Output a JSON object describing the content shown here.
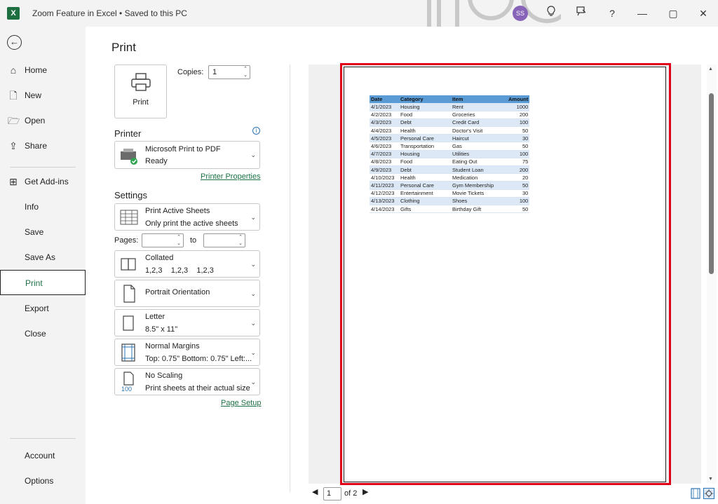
{
  "titlebar": {
    "app_logo": "X",
    "title": "Zoom Feature in Excel • Saved to this PC",
    "avatar_initials": "SS",
    "icons": [
      "lightbulb-icon",
      "coauthor-icon",
      "help-icon",
      "minimize-icon",
      "restore-icon",
      "close-icon"
    ],
    "glyphs": {
      "help": "?",
      "minimize": "—",
      "restore": "▢",
      "close": "✕"
    }
  },
  "nav": {
    "back_glyph": "←",
    "items": [
      {
        "label": "Home",
        "icon": "home-icon",
        "glyph": "⌂"
      },
      {
        "label": "New",
        "icon": "new-document-icon",
        "glyph": "🗋"
      },
      {
        "label": "Open",
        "icon": "open-folder-icon",
        "glyph": "🗁"
      },
      {
        "label": "Share",
        "icon": "share-icon",
        "glyph": "⇪"
      },
      {
        "label": "Get Add-ins",
        "icon": "add-ins-icon",
        "glyph": "⊞"
      },
      {
        "label": "Info"
      },
      {
        "label": "Save"
      },
      {
        "label": "Save As"
      },
      {
        "label": "Print",
        "active": true
      },
      {
        "label": "Export"
      },
      {
        "label": "Close"
      },
      {
        "label": "Account"
      },
      {
        "label": "Options"
      }
    ]
  },
  "print": {
    "title": "Print",
    "print_button_label": "Print",
    "copies_label": "Copies:",
    "copies_value": "1",
    "printer_heading": "Printer",
    "printer_name": "Microsoft Print to PDF",
    "printer_status": "Ready",
    "printer_properties_link": "Printer Properties",
    "settings_heading": "Settings",
    "settings": [
      {
        "line1": "Print Active Sheets",
        "line2": "Only print the active sheets",
        "icon": "sheets-icon"
      },
      {
        "line1": "Collated",
        "line2": "1,2,3    1,2,3    1,2,3",
        "icon": "collated-icon"
      },
      {
        "line1": "Portrait Orientation",
        "line2": "",
        "icon": "portrait-icon"
      },
      {
        "line1": "Letter",
        "line2": "8.5\" x 11\"",
        "icon": "paper-size-icon"
      },
      {
        "line1": "Normal Margins",
        "line2": "Top: 0.75\" Bottom: 0.75\" Left:...",
        "icon": "margins-icon"
      },
      {
        "line1": "No Scaling",
        "line2": "Print sheets at their actual size",
        "icon": "scaling-icon",
        "icon_text": "100"
      }
    ],
    "pages_label": "Pages:",
    "pages_from": "",
    "pages_to_label": "to",
    "pages_to": "",
    "page_setup_link": "Page Setup"
  },
  "preview": {
    "table": {
      "headers": [
        "Date",
        "Category",
        "Item",
        "Amount"
      ],
      "rows": [
        [
          "4/1/2023",
          "Housing",
          "Rent",
          "1000"
        ],
        [
          "4/2/2023",
          "Food",
          "Groceries",
          "200"
        ],
        [
          "4/3/2023",
          "Debt",
          "Credit Card",
          "100"
        ],
        [
          "4/4/2023",
          "Health",
          "Doctor's Visit",
          "50"
        ],
        [
          "4/5/2023",
          "Personal Care",
          "Haircut",
          "30"
        ],
        [
          "4/6/2023",
          "Transportation",
          "Gas",
          "50"
        ],
        [
          "4/7/2023",
          "Housing",
          "Utilities",
          "100"
        ],
        [
          "4/8/2023",
          "Food",
          "Eating Out",
          "75"
        ],
        [
          "4/9/2023",
          "Debt",
          "Student Loan",
          "200"
        ],
        [
          "4/10/2023",
          "Health",
          "Medication",
          "20"
        ],
        [
          "4/11/2023",
          "Personal Care",
          "Gym Membership",
          "50"
        ],
        [
          "4/12/2023",
          "Entertainment",
          "Movie Tickets",
          "30"
        ],
        [
          "4/13/2023",
          "Clothing",
          "Shoes",
          "100"
        ],
        [
          "4/14/2023",
          "Gifts",
          "Birthday Gift",
          "50"
        ]
      ]
    },
    "pager": {
      "current": "1",
      "of_label": "of 2",
      "prev_glyph": "◀",
      "next_glyph": "▶"
    }
  },
  "colors": {
    "accent": "#1e7145",
    "highlight_frame": "#e0001a",
    "table_header": "#5b9bd5",
    "avatar": "#8764b8"
  }
}
